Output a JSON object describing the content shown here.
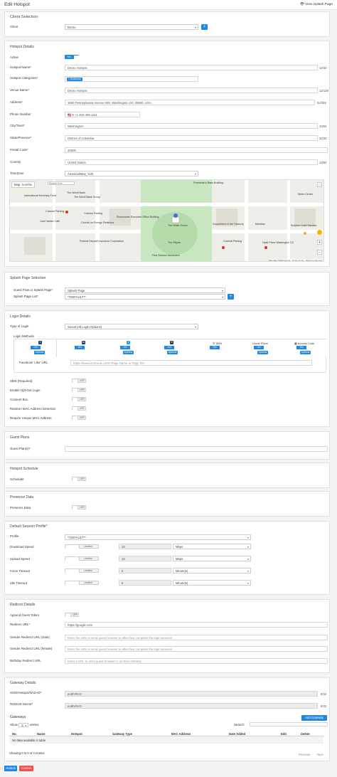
{
  "header": {
    "title": "Edit Hotspot",
    "view_link": "View Splash Page"
  },
  "client": {
    "section": "Client Selection",
    "label": "Client",
    "value": "Demo"
  },
  "hotspot": {
    "section": "Hotspot Details",
    "active_label": "Active",
    "active_state": "Yes",
    "name_label": "Hotspot Name",
    "name": "Demo Hotspot",
    "name_count": "12/32",
    "categories_label": "Hotspot Categories",
    "category_tag": "× Business",
    "venue_label": "Venue Name",
    "venue": "Demo Hotspot",
    "venue_count": "12/128",
    "address_label": "Address",
    "address": "1600 Pennsylvania Avenue NW, Washington, DC 20500, USA",
    "address_count": "54/256",
    "phone_label": "Phone Number",
    "phone_flag": "🇺🇸 ▾",
    "phone": "+1 202-456-1111",
    "city_label": "City/Town",
    "city": "Washington",
    "city_count": "10/64",
    "state_label": "State/Province",
    "state": "District of Columbia",
    "state_count": "20/32",
    "postal_label": "Postal Code",
    "postal": "20500",
    "country_label": "Country",
    "country": "United States",
    "country_count": "13/64",
    "timezone_label": "TimeZone",
    "timezone": "America/New_York"
  },
  "map": {
    "tab_map": "Map",
    "tab_satellite": "Satellite",
    "search_box": "Search Box",
    "labels": [
      "Freedman's Bank Building",
      "The World Bank",
      "The World Bank Group",
      "International Monetary Fund",
      "Colonial Parking",
      "Juan Valdez Café",
      "Council on Foreign Relations",
      "Federal Deposit Insurance Corporation",
      "Colonial Parking",
      "Eisenhower Executive Office Building",
      "The White House",
      "The Ellipse",
      "First Division Monument",
      "Department of the Treasury",
      "Colonial Parking",
      "Metro Center",
      "Meridian",
      "Kimpton Hotel Monaco",
      "Hyatt Place Washington DC"
    ],
    "attribution": "Map data ©2020 Google",
    "terms": "Terms of Use",
    "report": "Report a map error",
    "colors": {
      "park": "#c8e6c0",
      "road": "#ffffff",
      "water": "#aad3df",
      "pin": "#d93025"
    }
  },
  "splash": {
    "section": "Splash Page Selection",
    "guest_flow_label": "Guest Flow or Splash Page",
    "guest_flow": "Splash Page",
    "list_label": "Splash Page List",
    "list_value": "**DEFAULT**"
  },
  "login": {
    "section": "Login Details",
    "type_label": "Type of Login",
    "type_value": "Social (All Login Options)",
    "methods_label": "Login Methods",
    "methods": [
      {
        "name": "facebook",
        "icon": "f",
        "state": "ON",
        "options": "Options"
      },
      {
        "name": "linkedin",
        "icon": "in",
        "state": "ON",
        "options": ""
      },
      {
        "name": "twitter",
        "icon": "t",
        "state": "ON",
        "options": "Options"
      },
      {
        "name": "email",
        "icon": "✉",
        "state": "ON",
        "options": "Options"
      },
      {
        "name": "sms",
        "icon": "",
        "label": "✆ SMS",
        "state": "ON",
        "options": ""
      },
      {
        "name": "guest-plans",
        "icon": "",
        "label": "Guest Plans",
        "state": "ON",
        "options": "Options"
      },
      {
        "name": "access-code",
        "icon": "",
        "label": "▦ Access Code",
        "state": "ON",
        "options": "Options"
      }
    ],
    "fb_like_label": "Facebook 'Like' URL",
    "fb_like_placeholder": "https://www.facebook.com/<Page Name or Page ID>",
    "toggles": [
      {
        "label": "SMS (Required)",
        "state": "OFF"
      },
      {
        "label": "Enable Opt-Out Login",
        "state": "OFF"
      },
      {
        "label": "Consent Box",
        "state": "OFF"
      },
      {
        "label": "Random MAC Address Detection",
        "state": "OFF"
      },
      {
        "label": "Require Unique MAC Address",
        "state": "OFF"
      }
    ]
  },
  "guest_plans": {
    "section": "Guest Plans",
    "label": "Guest Plan(s)"
  },
  "schedule": {
    "section": "Hotspot Schedule",
    "label": "Scheduler",
    "state": "OFF"
  },
  "presence": {
    "section": "Presence Data",
    "label": "Presence Data",
    "state": "OFF"
  },
  "session": {
    "section": "Default Session Profile",
    "profile_label": "Profile",
    "profile": "**DEFAULT**",
    "rows": [
      {
        "label": "Download Speed",
        "toggle": "Limited",
        "value": "10",
        "unit": "Mbps"
      },
      {
        "label": "Upload Speed",
        "toggle": "Limited",
        "value": "10",
        "unit": "Mbps"
      },
      {
        "label": "Force Timeout",
        "toggle": "Limited",
        "value": "5",
        "unit": "Minute(s)"
      },
      {
        "label": "Idle Timeout",
        "toggle": "Limited",
        "value": "5",
        "unit": "Minute(s)"
      }
    ]
  },
  "redirect": {
    "section": "Redirect Details",
    "append_label": "Append Guest Token",
    "append_state": "OFF",
    "url_label": "Redirect URL",
    "url": "https://google.com",
    "male_label": "Gender Redirect URL (male)",
    "male_ph": "Enter the URL to send guest browser to after they complete the login process",
    "female_label": "Gender Redirect URL (female)",
    "female_ph": "Enter the URL to send guest browser to after they complete the login process",
    "birthday_label": "Birthday Redirect URL",
    "birthday_ph": "Enter a URL to send guest browser to on their birthday"
  },
  "gateway": {
    "section": "Gateway Details",
    "ssid_label": "SSID/Hotspot/NAS-ID",
    "ssid": "eu5tVRcG",
    "ssid_count": "8/32",
    "radius_label": "RADIUS Secret",
    "radius": "eu5tVRcG",
    "radius_count": "8/32",
    "gateways_label": "Gateways",
    "add_button": "Add Gateway",
    "show_label": "Show",
    "entries_value": "5",
    "entries_label": "entries",
    "search_label": "Search:",
    "columns": [
      "No.",
      "Name",
      "Hotspot",
      "Gateway Type",
      "MAC Address",
      "Date Added",
      "Edit",
      "Delete"
    ],
    "empty": "No data available in table",
    "info": "Showing 0 to 0 of 0 entries",
    "prev": "Previous",
    "next": "Next"
  },
  "footer": {
    "submit": "Submit",
    "cancel": "Cancel"
  },
  "colors": {
    "primary": "#1e88e5",
    "danger": "#ef5350"
  }
}
